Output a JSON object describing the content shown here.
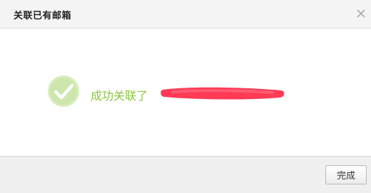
{
  "dialog": {
    "title": "关联已有邮箱",
    "close_icon": "close-icon",
    "message": "成功关联了",
    "redacted_color": "#ff3a55",
    "success_icon": "check-circle-icon",
    "success_color": "#8cc63f",
    "done_label": "完成"
  }
}
